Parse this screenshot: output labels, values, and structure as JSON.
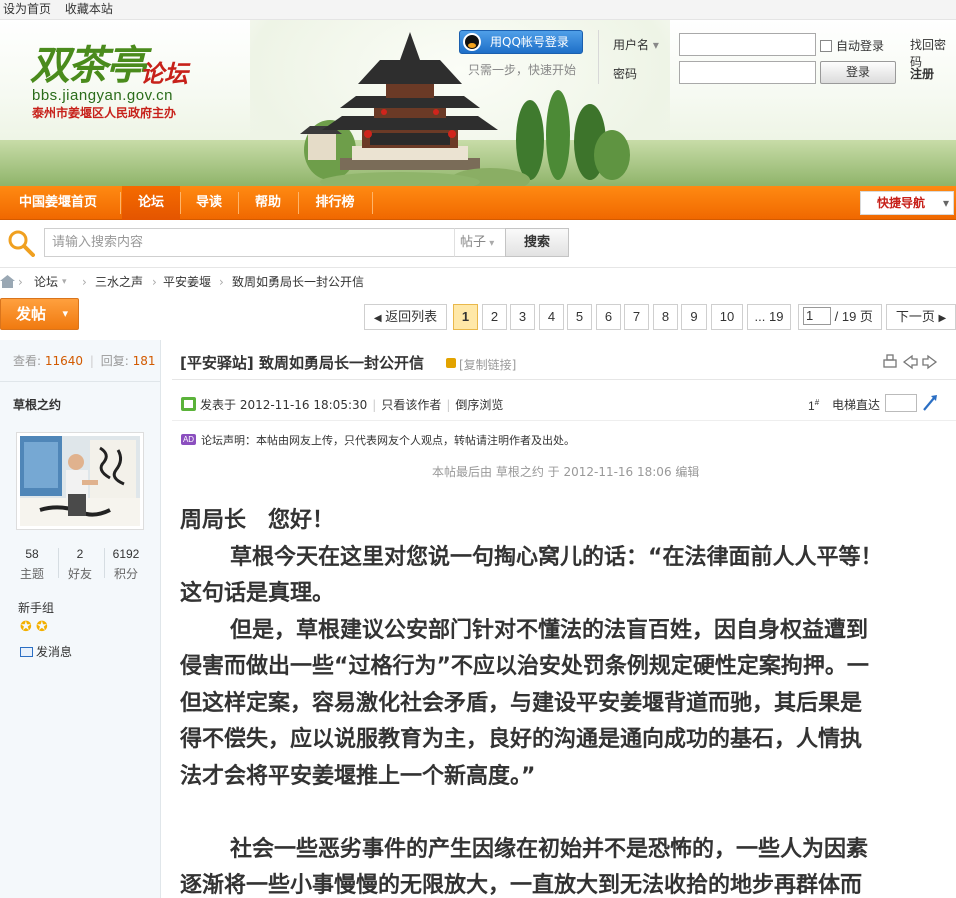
{
  "topbar": {
    "set_home": "设为首页",
    "bookmark": "收藏本站"
  },
  "logo": {
    "brand": "双茶亭",
    "sub": "论坛",
    "url": "bbs.jiangyan.gov.cn",
    "owner": "泰州市姜堰区人民政府主办"
  },
  "login": {
    "qq_button": "用QQ帐号登录",
    "qq_tip": "只需一步，快速开始",
    "username_label": "用户名",
    "password_label": "密码",
    "auto_login": "自动登录",
    "login_button": "登录",
    "find_password": "找回密码",
    "register": "注册"
  },
  "nav": {
    "items": [
      "中国姜堰首页",
      "论坛",
      "导读",
      "帮助",
      "排行榜"
    ],
    "active_index": 1,
    "quick_nav": "快捷导航"
  },
  "search": {
    "placeholder": "请输入搜索内容",
    "type": "帖子",
    "button": "搜索"
  },
  "breadcrumb": [
    "论坛",
    "三水之声",
    "平安姜堰",
    "致周如勇局长一封公开信"
  ],
  "toolbar": {
    "post_button": "发帖",
    "back_to_list": "返回列表",
    "pages": [
      "1",
      "2",
      "3",
      "4",
      "5",
      "6",
      "7",
      "8",
      "9",
      "10",
      "... 19"
    ],
    "current_page": "1",
    "total_pages": "/ 19 页",
    "next_page": "下一页"
  },
  "sidebar": {
    "views_label": "查看:",
    "views": "11640",
    "replies_label": "回复:",
    "replies": "181",
    "author": "草根之约",
    "stats": [
      {
        "value": "58",
        "label": "主题"
      },
      {
        "value": "2",
        "label": "好友"
      },
      {
        "value": "6192",
        "label": "积分"
      }
    ],
    "rank": "新手组",
    "stars": 2,
    "send_message": "发消息"
  },
  "post": {
    "category": "[平安驿站]",
    "title": "致周如勇局长一封公开信",
    "copy_link": "[复制链接]",
    "posted_at": "发表于 2012-11-16 18:05:30",
    "only_author": "只看该作者",
    "reverse": "倒序浏览",
    "floor": "1",
    "floor_mark": "#",
    "elevator": "电梯直达",
    "disclaimer": "论坛声明：本帖由网友上传，只代表网友个人观点，转帖请注明作者及出处。",
    "ad_badge": "AD",
    "edited": "本帖最后由 草根之约 于 2012-11-16 18:06 编辑",
    "lines": [
      {
        "text": "周局长　您好！",
        "indent": false
      },
      {
        "text": "草根今天在这里对您说一句掏心窝儿的话：“在法律面前人人平等！",
        "indent": true
      },
      {
        "text": "这句话是真理。",
        "indent": false
      },
      {
        "text": "但是，草根建议公安部门针对不懂法的法盲百姓，因自身权益遭到",
        "indent": true
      },
      {
        "text": "侵害而做出一些“过格行为”不应以治安处罚条例规定硬性定案拘押。一",
        "indent": false
      },
      {
        "text": "但这样定案，容易激化社会矛盾，与建设平安姜堰背道而驰，其后果是",
        "indent": false
      },
      {
        "text": "得不偿失，应以说服教育为主，良好的沟通是通向成功的基石，人情执",
        "indent": false
      },
      {
        "text": "法才会将平安姜堰推上一个新高度。”",
        "indent": false
      },
      {
        "text": "",
        "indent": false
      },
      {
        "text": "社会一些恶劣事件的产生因缘在初始并不是恐怖的，一些人为因素",
        "indent": true
      },
      {
        "text": "逐渐将一些小事慢慢的无限放大，一直放大到无法收拾的地步再群体而",
        "indent": false
      }
    ]
  },
  "colors": {
    "accent": "#f07a10",
    "nav_bg": "#f06800",
    "link_red": "#c7211a",
    "count": "#d25a00",
    "logo_green": "#4a8b1c"
  }
}
